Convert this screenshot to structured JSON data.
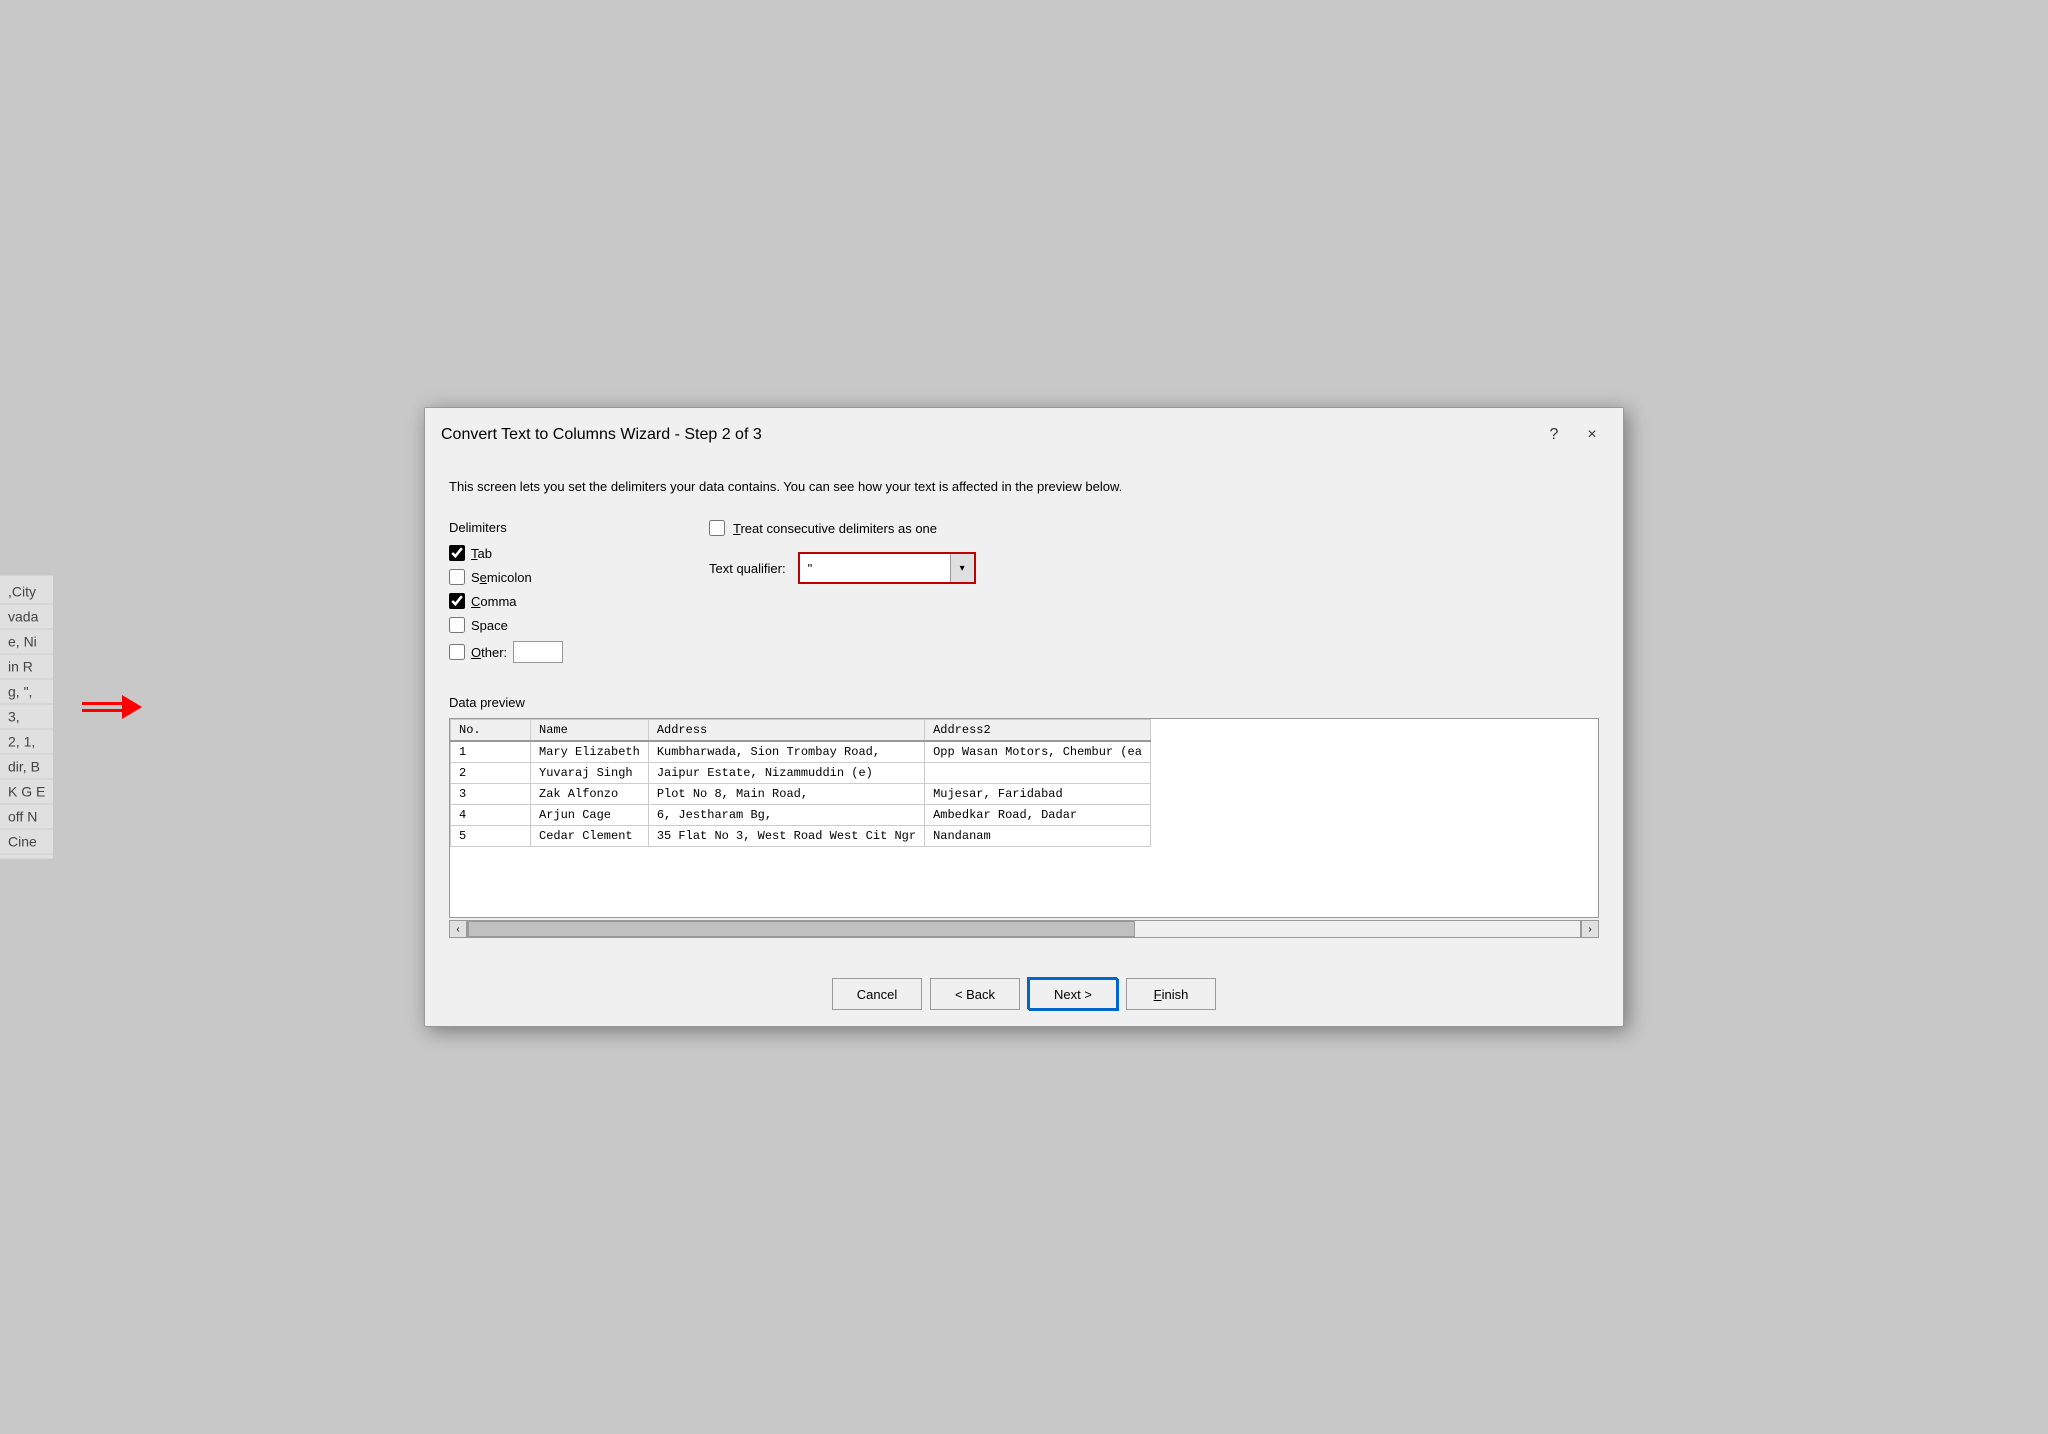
{
  "dialog": {
    "title": "Convert Text to Columns Wizard - Step 2 of 3",
    "help_btn": "?",
    "close_btn": "×",
    "description": "This screen lets you set the delimiters your data contains.  You can see how your text is affected in the preview below.",
    "delimiters": {
      "label": "Delimiters",
      "tab": {
        "label": "Tab",
        "checked": true
      },
      "semicolon": {
        "label": "Semicolon",
        "checked": false
      },
      "comma": {
        "label": "Comma",
        "checked": true
      },
      "space": {
        "label": "Space",
        "checked": false
      },
      "other": {
        "label": "Other:",
        "checked": false,
        "value": ""
      }
    },
    "consecutive": {
      "label": "Treat consecutive delimiters as one",
      "checked": false
    },
    "qualifier": {
      "label": "Text qualifier:",
      "value": "\""
    },
    "data_preview": {
      "label": "Data preview",
      "columns": [
        "No.",
        "Name",
        "Address",
        "Address2"
      ],
      "rows": [
        [
          "1",
          "Mary Elizabeth",
          "Kumbharwada, Sion Trombay Road,",
          "Opp Wasan Motors, Chembur (ea"
        ],
        [
          "2",
          "Yuvaraj Singh",
          "Jaipur Estate, Nizammuddin (e)",
          ""
        ],
        [
          "3",
          "Zak Alfonzo",
          "Plot No 8, Main Road,",
          "Mujesar, Faridabad"
        ],
        [
          "4",
          "Arjun Cage",
          "6, Jestharam Bg,",
          "Ambedkar Road, Dadar"
        ],
        [
          "5",
          "Cedar Clement",
          "35 Flat No 3, West Road West Cit Ngr",
          "Nandanam"
        ]
      ]
    },
    "footer": {
      "cancel": "Cancel",
      "back": "< Back",
      "next": "Next >",
      "finish": "Finish"
    }
  },
  "bg_text": [
    ",City",
    "vada",
    "e, Ni",
    "in R",
    "g, \",",
    "3,",
    "2, 1,",
    "dir, B",
    "K G E",
    "off N",
    "Cine"
  ],
  "icons": {
    "chevron_down": "▾",
    "scroll_left": "‹",
    "scroll_right": "›"
  }
}
